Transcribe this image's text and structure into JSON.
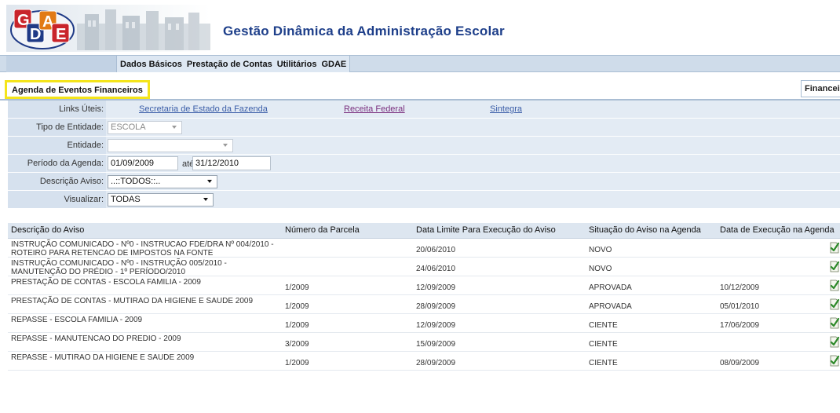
{
  "header": {
    "logo_text": "GDAE",
    "title": "Gestão Dinâmica da Administração Escolar"
  },
  "menu": {
    "items": [
      "Dados Básicos",
      "Prestação de Contas",
      "Utilitários",
      "GDAE"
    ]
  },
  "tabs": {
    "active": "Agenda de Eventos Financeiros",
    "right": "Financeir"
  },
  "filters": {
    "links_label": "Links Úteis:",
    "links": [
      "Secretaria de Estado da Fazenda",
      "Receita Federal",
      "Sintegra"
    ],
    "tipo_label": "Tipo de Entidade:",
    "tipo_value": "ESCOLA",
    "entidade_label": "Entidade:",
    "entidade_value": "",
    "periodo_label": "Período da Agenda:",
    "periodo_inicio": "01/09/2009",
    "ate_label": "até",
    "periodo_fim": "31/12/2010",
    "descricao_label": "Descrição Aviso:",
    "descricao_value": "..::TODOS::..",
    "visualizar_label": "Visualizar:",
    "visualizar_value": "TODAS"
  },
  "table": {
    "columns": [
      "Descrição do Aviso",
      "Número da Parcela",
      "Data Limite Para Execução do Aviso",
      "Situação do Aviso na Agenda",
      "Data de Execução na Agenda"
    ],
    "rows": [
      {
        "descricao": "INSTRUÇÃO COMUNICADO - Nº0 - INSTRUCAO FDE/DRA Nº 004/2010 - ROTEIRO PARA RETENCAO DE IMPOSTOS NA FONTE",
        "parcela": "",
        "data_limite": "20/06/2010",
        "situacao": "NOVO",
        "data_execucao": ""
      },
      {
        "descricao": "INSTRUÇÃO COMUNICADO - Nº0 - INSTRUÇÃO 005/2010 - MANUTENÇÃO DO PRÉDIO - 1º PERÍODO/2010",
        "parcela": "",
        "data_limite": "24/06/2010",
        "situacao": "NOVO",
        "data_execucao": ""
      },
      {
        "descricao": "PRESTAÇÃO DE CONTAS - ESCOLA FAMILIA - 2009",
        "parcela": "1/2009",
        "data_limite": "12/09/2009",
        "situacao": "APROVADA",
        "data_execucao": "10/12/2009"
      },
      {
        "descricao": "PRESTAÇÃO DE CONTAS - MUTIRAO DA HIGIENE E SAUDE 2009",
        "parcela": "1/2009",
        "data_limite": "28/09/2009",
        "situacao": "APROVADA",
        "data_execucao": "05/01/2010"
      },
      {
        "descricao": "REPASSE - ESCOLA FAMILIA - 2009",
        "parcela": "1/2009",
        "data_limite": "12/09/2009",
        "situacao": "CIENTE",
        "data_execucao": "17/06/2009"
      },
      {
        "descricao": "REPASSE - MANUTENCAO DO PREDIO - 2009",
        "parcela": "3/2009",
        "data_limite": "15/09/2009",
        "situacao": "CIENTE",
        "data_execucao": ""
      },
      {
        "descricao": "REPASSE - MUTIRAO DA HIGIENE E SAUDE 2009",
        "parcela": "1/2009",
        "data_limite": "28/09/2009",
        "situacao": "CIENTE",
        "data_execucao": "08/09/2009"
      }
    ]
  },
  "icons": {
    "row_action": "edit-document-icon"
  },
  "colors": {
    "title": "#1e3f8a",
    "highlight": "#f4e41a",
    "form_bg": "#e3ebf4"
  }
}
